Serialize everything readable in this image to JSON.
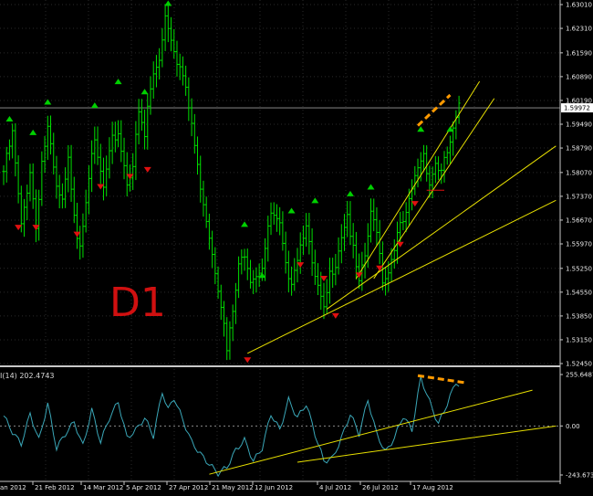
{
  "chart_data": [
    {
      "type": "candlestick",
      "timeframe_label": "D1",
      "ylim": [
        1.5245,
        1.6301
      ],
      "y_ticks": [
        "1.63010",
        "1.62310",
        "1.61590",
        "1.60890",
        "1.60190",
        "1.59490",
        "1.58790",
        "1.58070",
        "1.57370",
        "1.56670",
        "1.55970",
        "1.55250",
        "1.54550",
        "1.53850",
        "1.53150",
        "1.52450"
      ],
      "current_price": "1.59972",
      "x_labels": [
        "21 Feb 2012",
        "14 Mar 2012",
        "5 Apr 2012",
        "27 Apr 2012",
        "21 May 2012",
        "12 Jun 2012",
        "4 Jul 2012",
        "26 Jul 2012",
        "17 Aug 2012"
      ],
      "x_edge_label": "an 2012",
      "anchors": [
        {
          "bar": 0,
          "price": 1.581
        },
        {
          "bar": 3,
          "price": 1.592
        },
        {
          "bar": 6,
          "price": 1.5645
        },
        {
          "bar": 9,
          "price": 1.5815
        },
        {
          "bar": 11,
          "price": 1.5645
        },
        {
          "bar": 13,
          "price": 1.584
        },
        {
          "bar": 15,
          "price": 1.5935
        },
        {
          "bar": 18,
          "price": 1.5755
        },
        {
          "bar": 20,
          "price": 1.5715
        },
        {
          "bar": 22,
          "price": 1.584
        },
        {
          "bar": 25,
          "price": 1.5625
        },
        {
          "bar": 26,
          "price": 1.56
        },
        {
          "bar": 29,
          "price": 1.58
        },
        {
          "bar": 31,
          "price": 1.589
        },
        {
          "bar": 34,
          "price": 1.576
        },
        {
          "bar": 37,
          "price": 1.59
        },
        {
          "bar": 39,
          "price": 1.5925
        },
        {
          "bar": 42,
          "price": 1.578
        },
        {
          "bar": 44,
          "price": 1.583
        },
        {
          "bar": 46,
          "price": 1.598
        },
        {
          "bar": 48,
          "price": 1.591
        },
        {
          "bar": 49,
          "price": 1.6
        },
        {
          "bar": 51,
          "price": 1.6095
        },
        {
          "bar": 53,
          "price": 1.6145
        },
        {
          "bar": 55,
          "price": 1.627
        },
        {
          "bar": 57,
          "price": 1.621
        },
        {
          "bar": 59,
          "price": 1.614
        },
        {
          "bar": 61,
          "price": 1.609
        },
        {
          "bar": 64,
          "price": 1.595
        },
        {
          "bar": 66,
          "price": 1.582
        },
        {
          "bar": 69,
          "price": 1.5675
        },
        {
          "bar": 71,
          "price": 1.5575
        },
        {
          "bar": 74,
          "price": 1.5425
        },
        {
          "bar": 76,
          "price": 1.528
        },
        {
          "bar": 78,
          "price": 1.5395
        },
        {
          "bar": 80,
          "price": 1.5525
        },
        {
          "bar": 82,
          "price": 1.5575
        },
        {
          "bar": 84,
          "price": 1.55
        },
        {
          "bar": 86,
          "price": 1.551
        },
        {
          "bar": 88,
          "price": 1.5535
        },
        {
          "bar": 91,
          "price": 1.5685
        },
        {
          "bar": 94,
          "price": 1.5645
        },
        {
          "bar": 96,
          "price": 1.5525
        },
        {
          "bar": 98,
          "price": 1.5495
        },
        {
          "bar": 101,
          "price": 1.5595
        },
        {
          "bar": 103,
          "price": 1.5665
        },
        {
          "bar": 105,
          "price": 1.5525
        },
        {
          "bar": 107,
          "price": 1.5465
        },
        {
          "bar": 109,
          "price": 1.5395
        },
        {
          "bar": 111,
          "price": 1.5505
        },
        {
          "bar": 113,
          "price": 1.5545
        },
        {
          "bar": 115,
          "price": 1.5625
        },
        {
          "bar": 117,
          "price": 1.5685
        },
        {
          "bar": 119,
          "price": 1.5575
        },
        {
          "bar": 121,
          "price": 1.5475
        },
        {
          "bar": 123,
          "price": 1.556
        },
        {
          "bar": 125,
          "price": 1.568
        },
        {
          "bar": 127,
          "price": 1.5645
        },
        {
          "bar": 129,
          "price": 1.5495
        },
        {
          "bar": 131,
          "price": 1.5515
        },
        {
          "bar": 133,
          "price": 1.5595
        },
        {
          "bar": 135,
          "price": 1.5645
        },
        {
          "bar": 137,
          "price": 1.5675
        },
        {
          "bar": 139,
          "price": 1.5755
        },
        {
          "bar": 141,
          "price": 1.5825
        },
        {
          "bar": 143,
          "price": 1.5865
        },
        {
          "bar": 145,
          "price": 1.5775
        },
        {
          "bar": 147,
          "price": 1.5835
        },
        {
          "bar": 149,
          "price": 1.5805
        },
        {
          "bar": 151,
          "price": 1.5865
        },
        {
          "bar": 153,
          "price": 1.5925
        },
        {
          "bar": 155,
          "price": 1.5995
        }
      ],
      "fractals_up": [
        {
          "bar": 2,
          "price": 1.5965
        },
        {
          "bar": 10,
          "price": 1.5925
        },
        {
          "bar": 15,
          "price": 1.6015
        },
        {
          "bar": 31,
          "price": 1.6005
        },
        {
          "bar": 39,
          "price": 1.6075
        },
        {
          "bar": 48,
          "price": 1.6045
        },
        {
          "bar": 56,
          "price": 1.6305
        },
        {
          "bar": 82,
          "price": 1.5655
        },
        {
          "bar": 88,
          "price": 1.5505
        },
        {
          "bar": 98,
          "price": 1.5695
        },
        {
          "bar": 106,
          "price": 1.5725
        },
        {
          "bar": 118,
          "price": 1.5745
        },
        {
          "bar": 125,
          "price": 1.5765
        },
        {
          "bar": 142,
          "price": 1.5935
        },
        {
          "bar": 152,
          "price": 1.5935
        }
      ],
      "fractals_down": [
        {
          "bar": 5,
          "price": 1.5645
        },
        {
          "bar": 11,
          "price": 1.5645
        },
        {
          "bar": 25,
          "price": 1.5625
        },
        {
          "bar": 33,
          "price": 1.5765
        },
        {
          "bar": 43,
          "price": 1.5795
        },
        {
          "bar": 49,
          "price": 1.5815
        },
        {
          "bar": 83,
          "price": 1.5255
        },
        {
          "bar": 101,
          "price": 1.5535
        },
        {
          "bar": 109,
          "price": 1.5495
        },
        {
          "bar": 113,
          "price": 1.5385
        },
        {
          "bar": 121,
          "price": 1.5505
        },
        {
          "bar": 128,
          "price": 1.5525
        },
        {
          "bar": 135,
          "price": 1.5595
        },
        {
          "bar": 140,
          "price": 1.5715
        }
      ],
      "trendlines": [
        [
          {
            "bar": 83,
            "price": 1.5275
          },
          {
            "bar": 188,
            "price": 1.5725
          }
        ],
        [
          {
            "bar": 110,
            "price": 1.5405
          },
          {
            "bar": 188,
            "price": 1.5885
          }
        ],
        [
          {
            "bar": 126,
            "price": 1.5495
          },
          {
            "bar": 167,
            "price": 1.6025
          }
        ],
        [
          {
            "bar": 120,
            "price": 1.5495
          },
          {
            "bar": 162,
            "price": 1.6075
          }
        ]
      ],
      "dashed_line": [
        {
          "bar": 141,
          "price": 1.5945
        },
        {
          "bar": 152,
          "price": 1.6035
        }
      ],
      "red_segment": [
        {
          "bar": 144,
          "price": 1.5755
        },
        {
          "bar": 150,
          "price": 1.5755
        }
      ],
      "colors": {
        "bull": "#00e000",
        "bear": "#00e000",
        "up_arrow": "#00d000",
        "down_arrow": "#e01010",
        "trend": "#e8e000",
        "dashed": "#ff9a00",
        "price_tag": "#ffffff",
        "grid": "#2a2a2a"
      }
    },
    {
      "type": "line",
      "indicator_label": "I(14) 202.4743",
      "ylim": [
        -243.673,
        255.6487
      ],
      "y_ticks": [
        "255.6487",
        "0.00",
        "-243.673"
      ],
      "anchors": [
        {
          "bar": 0,
          "value": 50
        },
        {
          "bar": 3,
          "value": -30
        },
        {
          "bar": 6,
          "value": -90
        },
        {
          "bar": 9,
          "value": 60
        },
        {
          "bar": 12,
          "value": -70
        },
        {
          "bar": 15,
          "value": 110
        },
        {
          "bar": 18,
          "value": -110
        },
        {
          "bar": 21,
          "value": -40
        },
        {
          "bar": 24,
          "value": 20
        },
        {
          "bar": 27,
          "value": -100
        },
        {
          "bar": 30,
          "value": 80
        },
        {
          "bar": 33,
          "value": -80
        },
        {
          "bar": 36,
          "value": 40
        },
        {
          "bar": 39,
          "value": 120
        },
        {
          "bar": 42,
          "value": -60
        },
        {
          "bar": 45,
          "value": -20
        },
        {
          "bar": 48,
          "value": 40
        },
        {
          "bar": 51,
          "value": -50
        },
        {
          "bar": 54,
          "value": 170
        },
        {
          "bar": 56,
          "value": 80
        },
        {
          "bar": 58,
          "value": 140
        },
        {
          "bar": 61,
          "value": 30
        },
        {
          "bar": 64,
          "value": -80
        },
        {
          "bar": 67,
          "value": -140
        },
        {
          "bar": 70,
          "value": -190
        },
        {
          "bar": 73,
          "value": -235
        },
        {
          "bar": 76,
          "value": -205
        },
        {
          "bar": 79,
          "value": -120
        },
        {
          "bar": 82,
          "value": -70
        },
        {
          "bar": 85,
          "value": -175
        },
        {
          "bar": 88,
          "value": -110
        },
        {
          "bar": 91,
          "value": 60
        },
        {
          "bar": 94,
          "value": -20
        },
        {
          "bar": 97,
          "value": 130
        },
        {
          "bar": 100,
          "value": 40
        },
        {
          "bar": 103,
          "value": 110
        },
        {
          "bar": 106,
          "value": -40
        },
        {
          "bar": 109,
          "value": -175
        },
        {
          "bar": 112,
          "value": -160
        },
        {
          "bar": 115,
          "value": -60
        },
        {
          "bar": 118,
          "value": 60
        },
        {
          "bar": 121,
          "value": -40
        },
        {
          "bar": 124,
          "value": 130
        },
        {
          "bar": 127,
          "value": -40
        },
        {
          "bar": 130,
          "value": -130
        },
        {
          "bar": 133,
          "value": -60
        },
        {
          "bar": 136,
          "value": 50
        },
        {
          "bar": 139,
          "value": -20
        },
        {
          "bar": 142,
          "value": 240
        },
        {
          "bar": 145,
          "value": 120
        },
        {
          "bar": 148,
          "value": 10
        },
        {
          "bar": 151,
          "value": 110
        },
        {
          "bar": 154,
          "value": 220
        },
        {
          "bar": 155,
          "value": 202
        }
      ],
      "trendlines": [
        [
          {
            "bar": 70,
            "value": -240
          },
          {
            "bar": 180,
            "value": 178
          }
        ],
        [
          {
            "bar": 100,
            "value": -180
          },
          {
            "bar": 188,
            "value": 0
          }
        ]
      ],
      "dashed_line": [
        {
          "bar": 141,
          "value": 250
        },
        {
          "bar": 157,
          "value": 215
        }
      ],
      "colors": {
        "line": "#3aa7b8",
        "trend": "#e8e000",
        "dashed": "#ff9a00",
        "zero": "#888888"
      }
    }
  ]
}
